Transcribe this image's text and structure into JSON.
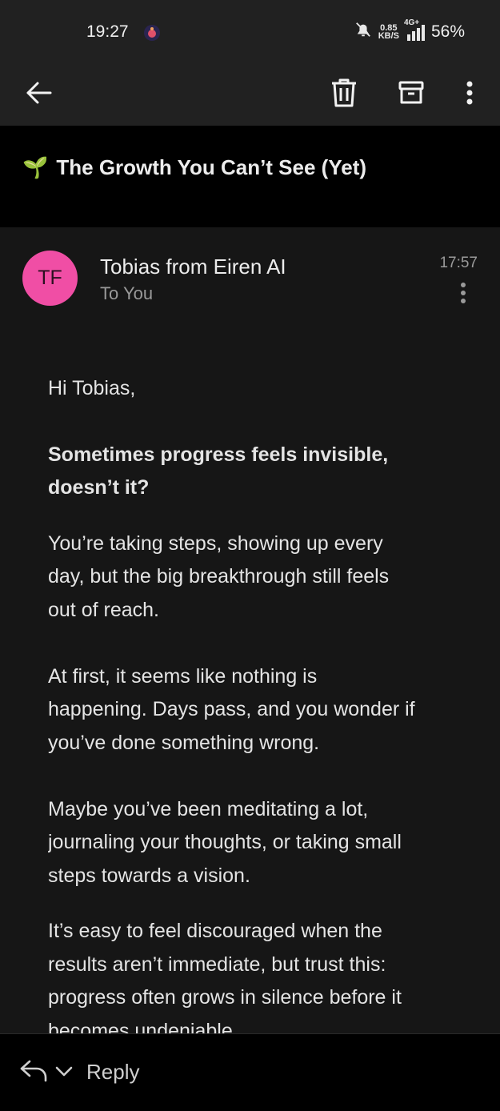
{
  "status_bar": {
    "time": "19:27",
    "net_speed_value": "0.85",
    "net_speed_unit": "KB/S",
    "network_type": "4G+",
    "battery": "56%",
    "icons": [
      "app-notification-icon",
      "bell-muted-icon",
      "signal-icon"
    ]
  },
  "toolbar": {
    "icons": [
      "back-arrow-icon",
      "trash-icon",
      "archive-icon",
      "more-vert-icon"
    ]
  },
  "email": {
    "subject_emoji": "🌱",
    "subject": "The Growth You Can’t See (Yet)",
    "avatar_initials": "TF",
    "avatar_color": "#f04ea5",
    "sender": "Tobias from Eiren AI",
    "recipient": "To You",
    "time": "17:57",
    "greeting": "Hi Tobias,",
    "headline_line1": "Sometimes progress feels invisible,",
    "headline_line2": "doesn’t it?",
    "para1_line1": "You’re taking steps, showing up every",
    "para1_line2": "day, but the big breakthrough still feels",
    "para1_line3": "out of reach.",
    "para2_line1": "At first, it seems like nothing is",
    "para2_line2": "happening. Days pass, and you wonder if",
    "para2_line3": "you’ve done something wrong.",
    "para3_line1": "Maybe you’ve been meditating a lot,",
    "para3_line2": "journaling your thoughts, or taking small",
    "para3_line3": "steps towards a vision.",
    "para4_line1": "It’s easy to feel discouraged when the",
    "para4_line2": "results aren’t immediate, but trust this:",
    "para4_line3": "progress often grows in silence before it",
    "para4_line4": "becomes undeniable."
  },
  "reply_bar": {
    "label": "Reply"
  }
}
